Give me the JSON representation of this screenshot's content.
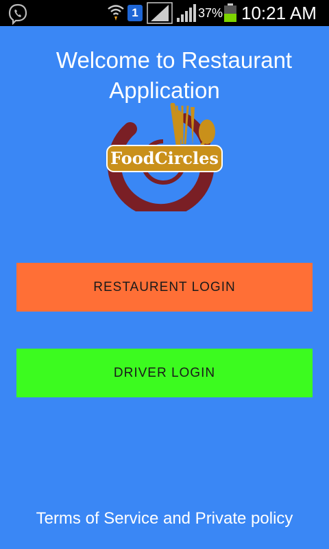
{
  "status_bar": {
    "sim_slot": "1",
    "battery_percent": "37%",
    "time": "10:21 AM",
    "icons": [
      "viber-icon",
      "wifi-icon",
      "sim-icon",
      "signal-icon",
      "battery-icon"
    ]
  },
  "welcome": {
    "line1": "Welcome to Restaurant",
    "line2": "Application"
  },
  "logo": {
    "text": "FoodCircles"
  },
  "buttons": {
    "restaurant_login": "RESTAURENT LOGIN",
    "driver_login": "DRIVER LOGIN"
  },
  "footer": {
    "terms": "Terms of Service and Private policy"
  },
  "colors": {
    "background": "#3a87f5",
    "restaurant_button": "#ff6f36",
    "driver_button": "#3cfb1f",
    "logo_ring": "#7a1f25",
    "logo_gold": "#c9901a"
  }
}
